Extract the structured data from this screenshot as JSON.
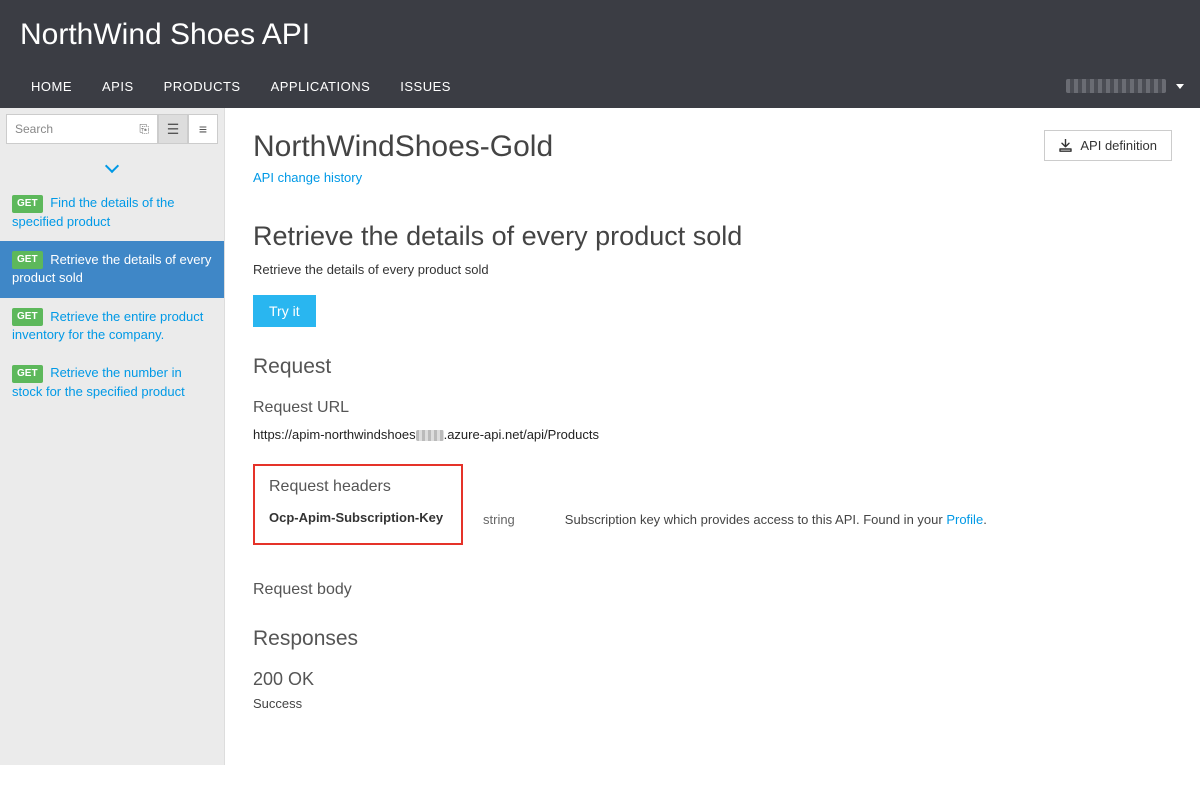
{
  "portal": {
    "title": "NorthWind Shoes API"
  },
  "nav": {
    "items": [
      "HOME",
      "APIS",
      "PRODUCTS",
      "APPLICATIONS",
      "ISSUES"
    ]
  },
  "sidebar": {
    "search_placeholder": "Search",
    "operations": [
      {
        "method": "GET",
        "label": "Find the details of the specified product",
        "active": false
      },
      {
        "method": "GET",
        "label": "Retrieve the details of every product sold",
        "active": true
      },
      {
        "method": "GET",
        "label": "Retrieve the entire product inventory for the company.",
        "active": false
      },
      {
        "method": "GET",
        "label": "Retrieve the number in stock for the specified product",
        "active": false
      }
    ]
  },
  "api": {
    "title": "NorthWindShoes-Gold",
    "change_history": "API change history",
    "definition_label": "API definition"
  },
  "operation": {
    "title": "Retrieve the details of every product sold",
    "description": "Retrieve the details of every product sold",
    "try_label": "Try it"
  },
  "request": {
    "heading": "Request",
    "url_heading": "Request URL",
    "url_prefix": "https://apim-northwindshoes",
    "url_suffix": ".azure-api.net/api/Products",
    "headers_heading": "Request headers",
    "headers": [
      {
        "name": "Ocp-Apim-Subscription-Key",
        "type": "string",
        "desc": "Subscription key which provides access to this API. Found in your ",
        "link": "Profile",
        "tail": "."
      }
    ],
    "body_heading": "Request body"
  },
  "responses": {
    "heading": "Responses",
    "code": "200 OK",
    "text": "Success"
  }
}
